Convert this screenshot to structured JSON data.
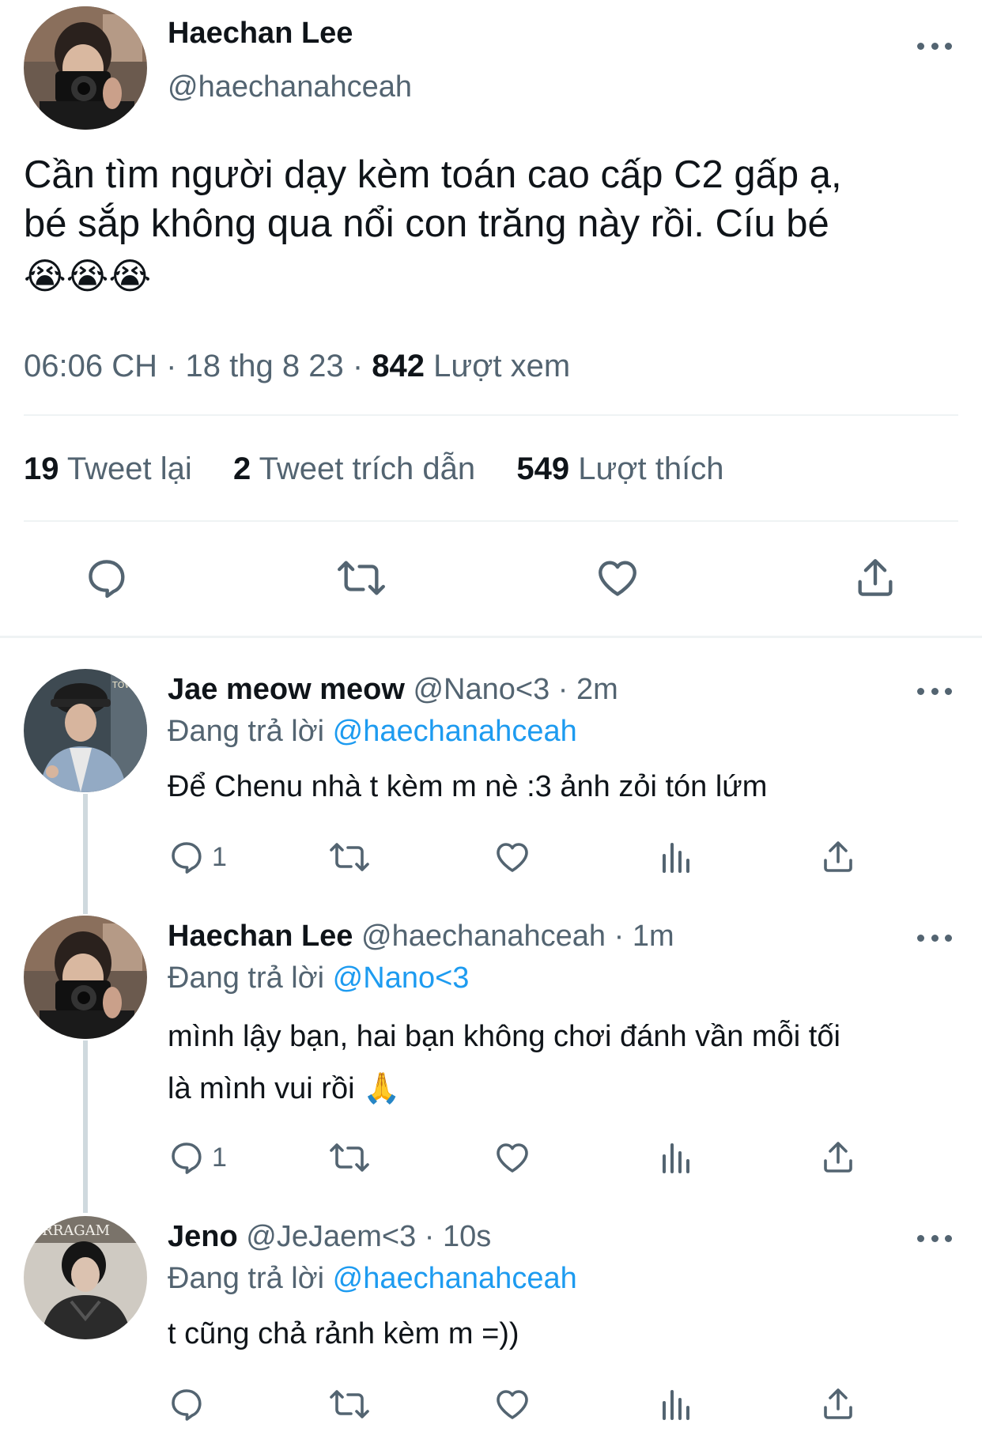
{
  "main_tweet": {
    "author_name": "Haechan Lee",
    "author_handle": "@haechanahceah",
    "text_line1": "Cần tìm người dạy kèm toán cao cấp C2 gấp ạ,",
    "text_line2": "bé sắp không qua nổi con trăng này rồi. Cíu bé",
    "emojis": "😭😭😭",
    "time": "06:06 CH",
    "date": "18 thg 8 23",
    "views_count": "842",
    "views_label": "Lượt xem",
    "retweets_count": "19",
    "retweets_label": "Tweet lại",
    "quotes_count": "2",
    "quotes_label": "Tweet trích dẫn",
    "likes_count": "549",
    "likes_label": "Lượt thích"
  },
  "replies": [
    {
      "name": "Jae meow meow",
      "handle": "@Nano<3",
      "age": "2m",
      "replying_label": "Đang trả lời",
      "replying_to": "@haechanahceah",
      "text_line1": "Để Chenu nhà t kèm m nè :3 ảnh zỏi tón lứm",
      "text_line2": "",
      "reply_count": "1"
    },
    {
      "name": "Haechan Lee",
      "handle": "@haechanahceah",
      "age": "1m",
      "replying_label": "Đang trả lời",
      "replying_to": "@Nano<3",
      "text_line1": "mình lậy bạn, hai bạn không chơi đánh vần mỗi tối",
      "text_line2": "là mình vui rồi 🙏",
      "reply_count": "1"
    },
    {
      "name": "Jeno",
      "handle": "@JeJaem<3",
      "age": "10s",
      "replying_label": "Đang trả lời",
      "replying_to": "@haechanahceah",
      "text_line1": "t cũng chả rảnh kèm m =))",
      "text_line2": "",
      "reply_count": ""
    }
  ],
  "avatar_texts": {
    "jae_sign": "TOW",
    "jeno_sign": "ERRAGAM"
  },
  "icons": [
    "more-icon",
    "reply-icon",
    "retweet-icon",
    "like-icon",
    "share-icon",
    "views-icon"
  ],
  "colors": {
    "text": "#0f1419",
    "muted": "#536471",
    "link": "#1d9bf0",
    "divider": "#eff3f4",
    "thread": "#cfd9de"
  }
}
